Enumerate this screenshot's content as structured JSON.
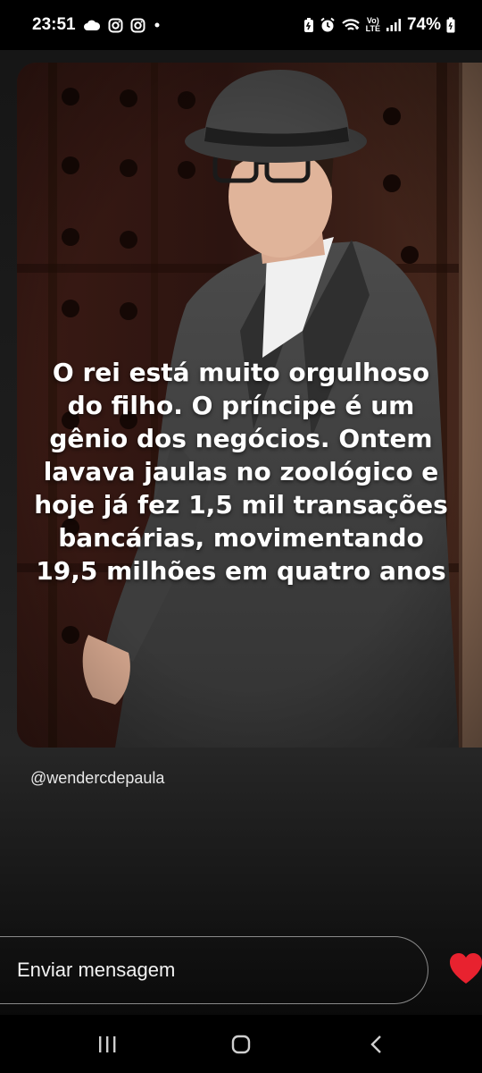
{
  "status_bar": {
    "time": "23:51",
    "battery": "74%",
    "network_top": "Vo)",
    "network_bottom": "LTE",
    "icons": [
      "cloud-icon",
      "instagram-icon",
      "instagram-icon",
      "dot-icon",
      "battery-saver-icon",
      "alarm-icon",
      "wifi-icon",
      "signal-icon",
      "battery-icon"
    ]
  },
  "story": {
    "overlay_text": "O rei está muito orgulhoso\ndo filho. O príncipe é um\ngênio dos negócios. Ontem\nlavava jaulas no zoológico e\nhoje já fez 1,5 mil transações\nbancárias, movimentando\n19,5 milhões em quatro anos",
    "username": "@wendercdepaula"
  },
  "reply": {
    "placeholder": "Enviar mensagem",
    "like_icon": "heart-icon",
    "like_color": "#e8222f"
  },
  "nav_bar": {
    "icons": [
      "recents-icon",
      "home-icon",
      "back-icon"
    ]
  }
}
